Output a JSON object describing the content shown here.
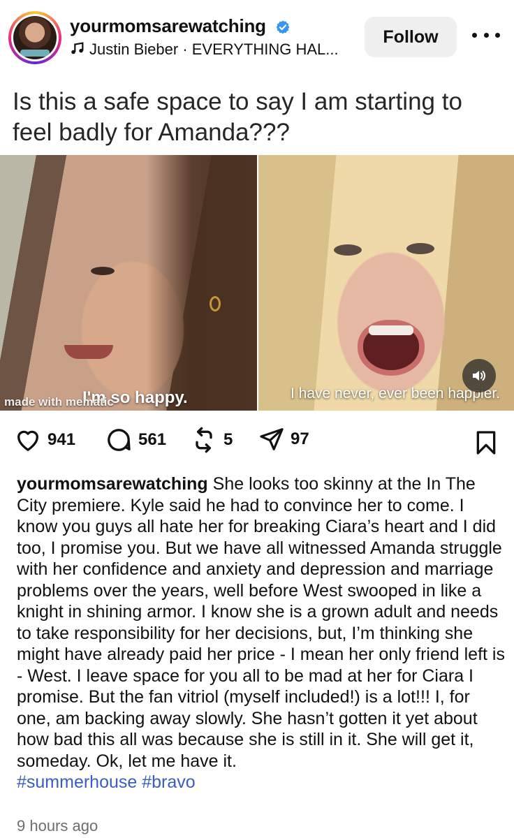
{
  "header": {
    "username": "yourmomsarewatching",
    "audio": "Justin Bieber · EVERYTHING HAL...",
    "follow_label": "Follow"
  },
  "post": {
    "headline": "Is this a safe space to say I am starting to feel badly for Amanda???",
    "media": {
      "subtitle_left": "I'm so happy.",
      "watermark": "made with mematic",
      "subtitle_right": "I have never, ever been happier."
    },
    "actions": {
      "likes": "941",
      "comments": "561",
      "reposts": "5",
      "shares": "97"
    },
    "caption": {
      "username": "yourmomsarewatching",
      "text": "She looks too skinny at the In The City premiere. Kyle said he had to convince her to come. I know you guys all hate her for breaking Ciara’s heart and I did too, I promise you. But we have all witnessed Amanda struggle with her confidence and anxiety and depression and marriage problems over the years, well before West swooped in like a knight in shining armor. I know she is a grown adult and needs to take responsibility for her decisions, but, I’m thinking she might have already paid her price - I mean her only friend left is - West. I leave space for you all to be mad at her for Ciara I promise. But the fan vitriol (myself included!) is a lot!!! I, for one, am backing away slowly.  She hasn’t gotten it yet about how bad this all was because she is still in it.  She will get it, someday.  Ok, let me have it.",
      "hashtags": "#summerhouse #bravo"
    },
    "timestamp": "9 hours ago"
  },
  "colors": {
    "hashtag": "#3b5cc4",
    "verified": "#3797f0",
    "follow_bg": "#efefef"
  },
  "icons": [
    "verified-badge-icon",
    "music-note-icon",
    "more-icon",
    "heart-icon",
    "comment-icon",
    "repost-icon",
    "share-icon",
    "bookmark-icon",
    "sound-icon"
  ]
}
